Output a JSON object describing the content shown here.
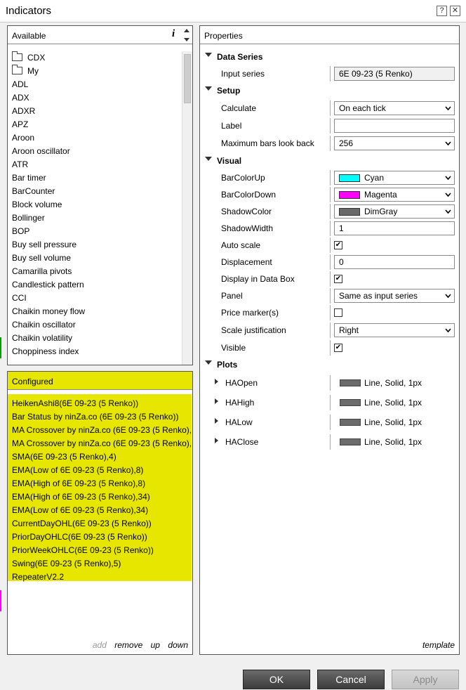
{
  "window": {
    "title": "Indicators",
    "help": "?",
    "close": "✕"
  },
  "available": {
    "header": "Available",
    "info_icon": "i",
    "folders": [
      "CDX",
      "My"
    ],
    "items": [
      "ADL",
      "ADX",
      "ADXR",
      "APZ",
      "Aroon",
      "Aroon oscillator",
      "ATR",
      "Bar timer",
      "BarCounter",
      "Block volume",
      "Bollinger",
      "BOP",
      "Buy sell pressure",
      "Buy sell volume",
      "Camarilla pivots",
      "Candlestick pattern",
      "CCI",
      "Chaikin money flow",
      "Chaikin oscillator",
      "Chaikin volatility",
      "Choppiness index"
    ]
  },
  "configured": {
    "header": "Configured",
    "items": [
      "HeikenAshi8(6E 09-23 (5 Renko))",
      "Bar Status by ninZa.co (6E 09-23 (5 Renko))",
      "MA Crossover by ninZa.co (6E 09-23 (5 Renko),",
      "MA Crossover by ninZa.co (6E 09-23 (5 Renko),",
      "SMA(6E 09-23 (5 Renko),4)",
      "EMA(Low of 6E 09-23 (5 Renko),8)",
      "EMA(High of 6E 09-23 (5 Renko),8)",
      "EMA(High of 6E 09-23 (5 Renko),34)",
      "EMA(Low of 6E 09-23 (5 Renko),34)",
      "CurrentDayOHL(6E 09-23 (5 Renko))",
      "PriorDayOHLC(6E 09-23 (5 Renko))",
      "PriorWeekOHLC(6E 09-23 (5 Renko))",
      "Swing(6E 09-23 (5 Renko),5)",
      "RepeaterV2.2"
    ],
    "highlight_color": "#e6e600",
    "actions": {
      "add": "add",
      "remove": "remove",
      "up": "up",
      "down": "down"
    }
  },
  "properties": {
    "header": "Properties",
    "data_series": {
      "label": "Data Series",
      "input_series_label": "Input series",
      "input_series_value": "6E 09-23 (5 Renko)"
    },
    "setup": {
      "label": "Setup",
      "calculate_label": "Calculate",
      "calculate_value": "On each tick",
      "label_label": "Label",
      "label_value": "",
      "max_bars_label": "Maximum bars look back",
      "max_bars_value": "256"
    },
    "visual": {
      "label": "Visual",
      "bar_color_up_label": "BarColorUp",
      "bar_color_up_value": "Cyan",
      "bar_color_up_hex": "#00ffff",
      "bar_color_down_label": "BarColorDown",
      "bar_color_down_value": "Magenta",
      "bar_color_down_hex": "#ff00ff",
      "shadow_color_label": "ShadowColor",
      "shadow_color_value": "DimGray",
      "shadow_color_hex": "#696969",
      "shadow_width_label": "ShadowWidth",
      "shadow_width_value": "1",
      "auto_scale_label": "Auto scale",
      "auto_scale_checked": true,
      "displacement_label": "Displacement",
      "displacement_value": "0",
      "display_in_data_box_label": "Display in Data Box",
      "display_in_data_box_checked": true,
      "panel_label": "Panel",
      "panel_value": "Same as input series",
      "price_markers_label": "Price marker(s)",
      "price_markers_checked": false,
      "scale_justification_label": "Scale justification",
      "scale_justification_value": "Right",
      "visible_label": "Visible",
      "visible_checked": true
    },
    "plots": {
      "label": "Plots",
      "items": [
        {
          "name": "HAOpen",
          "value": "Line, Solid, 1px"
        },
        {
          "name": "HAHigh",
          "value": "Line, Solid, 1px"
        },
        {
          "name": "HALow",
          "value": "Line, Solid, 1px"
        },
        {
          "name": "HAClose",
          "value": "Line, Solid, 1px"
        }
      ]
    },
    "template_link": "template"
  },
  "buttons": {
    "ok": "OK",
    "cancel": "Cancel",
    "apply": "Apply"
  }
}
